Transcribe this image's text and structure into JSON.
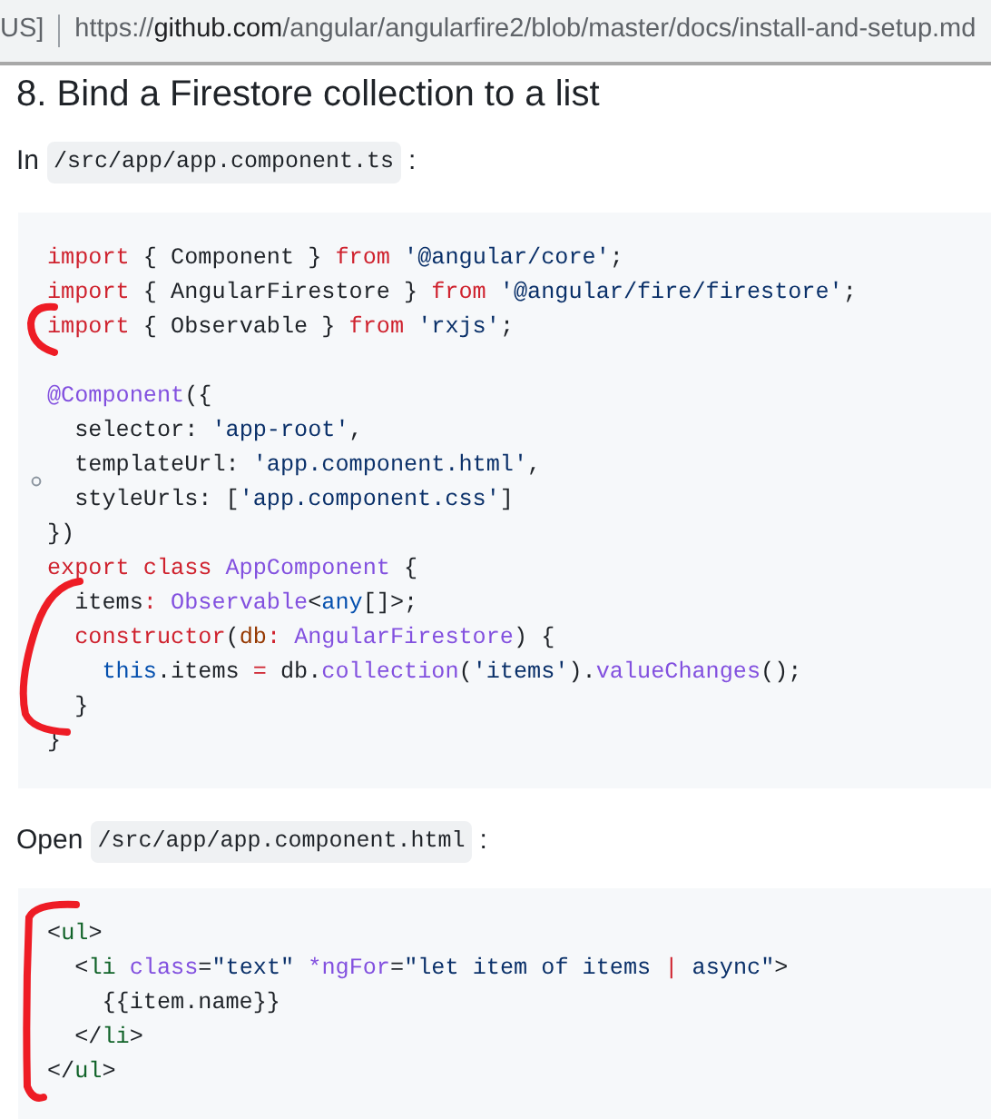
{
  "address_bar": {
    "site_label": "US]",
    "url": [
      {
        "kind": "scheme",
        "text": "https://"
      },
      {
        "kind": "host",
        "text": "github.com"
      },
      {
        "kind": "path",
        "text": "/angular/angularfire2/blob/master/docs/install-and-setup.md"
      }
    ]
  },
  "heading": "8. Bind a Firestore collection to a list",
  "sections": [
    {
      "intro": {
        "before": "In",
        "code": "/src/app/app.component.ts",
        "after": ":"
      },
      "code_lines": [
        {
          "tokens": [
            {
              "kind": "kw",
              "text": "import"
            },
            {
              "kind": "plain",
              "text": " { Component } "
            },
            {
              "kind": "kw",
              "text": "from "
            },
            {
              "kind": "str",
              "text": "'@angular/core'"
            },
            {
              "kind": "plain",
              "text": ";"
            }
          ]
        },
        {
          "tokens": [
            {
              "kind": "kw",
              "text": "import"
            },
            {
              "kind": "plain",
              "text": " { AngularFirestore } "
            },
            {
              "kind": "kw",
              "text": "from "
            },
            {
              "kind": "str",
              "text": "'@angular/fire/firestore'"
            },
            {
              "kind": "plain",
              "text": ";"
            }
          ]
        },
        {
          "tokens": [
            {
              "kind": "kw",
              "text": "import"
            },
            {
              "kind": "plain",
              "text": " { Observable } "
            },
            {
              "kind": "kw",
              "text": "from "
            },
            {
              "kind": "str",
              "text": "'rxjs'"
            },
            {
              "kind": "plain",
              "text": ";"
            }
          ]
        },
        {
          "kind": "blank"
        },
        {
          "tokens": [
            {
              "kind": "ent",
              "text": "@Component"
            },
            {
              "kind": "plain",
              "text": "({"
            }
          ]
        },
        {
          "tokens": [
            {
              "kind": "plain",
              "text": "  selector: "
            },
            {
              "kind": "str",
              "text": "'app-root'"
            },
            {
              "kind": "plain",
              "text": ","
            }
          ]
        },
        {
          "tokens": [
            {
              "kind": "plain",
              "text": "  templateUrl: "
            },
            {
              "kind": "str",
              "text": "'app.component.html'"
            },
            {
              "kind": "plain",
              "text": ","
            }
          ]
        },
        {
          "tokens": [
            {
              "kind": "plain",
              "text": "  styleUrls: ["
            },
            {
              "kind": "str",
              "text": "'app.component.css'"
            },
            {
              "kind": "plain",
              "text": "]"
            }
          ]
        },
        {
          "tokens": [
            {
              "kind": "plain",
              "text": "})"
            }
          ]
        },
        {
          "tokens": [
            {
              "kind": "kw",
              "text": "export class "
            },
            {
              "kind": "ent",
              "text": "AppComponent"
            },
            {
              "kind": "plain",
              "text": " {"
            }
          ]
        },
        {
          "tokens": [
            {
              "kind": "plain",
              "text": "  items"
            },
            {
              "kind": "kw",
              "text": ": "
            },
            {
              "kind": "ent",
              "text": "Observable"
            },
            {
              "kind": "plain",
              "text": "<"
            },
            {
              "kind": "const",
              "text": "any"
            },
            {
              "kind": "plain",
              "text": "[]>;"
            }
          ]
        },
        {
          "tokens": [
            {
              "kind": "kw",
              "text": "  constructor"
            },
            {
              "kind": "plain",
              "text": "("
            },
            {
              "kind": "var",
              "text": "db"
            },
            {
              "kind": "kw",
              "text": ": "
            },
            {
              "kind": "ent",
              "text": "AngularFirestore"
            },
            {
              "kind": "plain",
              "text": ") {"
            }
          ]
        },
        {
          "tokens": [
            {
              "kind": "const",
              "text": "    this"
            },
            {
              "kind": "plain",
              "text": ".items "
            },
            {
              "kind": "kw",
              "text": "="
            },
            {
              "kind": "plain",
              "text": " db."
            },
            {
              "kind": "ent",
              "text": "collection"
            },
            {
              "kind": "plain",
              "text": "("
            },
            {
              "kind": "str",
              "text": "'items'"
            },
            {
              "kind": "plain",
              "text": ")."
            },
            {
              "kind": "ent",
              "text": "valueChanges"
            },
            {
              "kind": "plain",
              "text": "();"
            }
          ]
        },
        {
          "tokens": [
            {
              "kind": "plain",
              "text": "  }"
            }
          ]
        },
        {
          "tokens": [
            {
              "kind": "plain",
              "text": "}"
            }
          ]
        }
      ]
    },
    {
      "intro": {
        "before": "Open",
        "code": "/src/app/app.component.html",
        "after": ":"
      },
      "code_lines": [
        {
          "tokens": [
            {
              "kind": "plain",
              "text": "<"
            },
            {
              "kind": "tag",
              "text": "ul"
            },
            {
              "kind": "plain",
              "text": ">"
            }
          ]
        },
        {
          "tokens": [
            {
              "kind": "plain",
              "text": "  <"
            },
            {
              "kind": "tag",
              "text": "li "
            },
            {
              "kind": "ent",
              "text": "class"
            },
            {
              "kind": "plain",
              "text": "="
            },
            {
              "kind": "str",
              "text": "\"text\" "
            },
            {
              "kind": "ent",
              "text": "*ngFor"
            },
            {
              "kind": "plain",
              "text": "="
            },
            {
              "kind": "str",
              "text": "\"let item of items "
            },
            {
              "kind": "kw",
              "text": "|"
            },
            {
              "kind": "str",
              "text": " async\""
            },
            {
              "kind": "plain",
              "text": ">"
            }
          ]
        },
        {
          "tokens": [
            {
              "kind": "plain",
              "text": "    {{item.name}}"
            }
          ]
        },
        {
          "tokens": [
            {
              "kind": "plain",
              "text": "  </"
            },
            {
              "kind": "tag",
              "text": "li"
            },
            {
              "kind": "plain",
              "text": ">"
            }
          ]
        },
        {
          "tokens": [
            {
              "kind": "plain",
              "text": "</"
            },
            {
              "kind": "tag",
              "text": "ul"
            },
            {
              "kind": "plain",
              "text": ">"
            }
          ]
        }
      ]
    }
  ]
}
